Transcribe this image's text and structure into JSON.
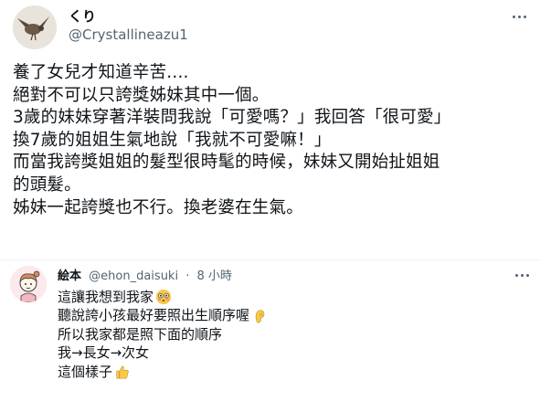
{
  "tweet": {
    "author_name": "くり",
    "author_handle": "@Crystallineazu1",
    "lines": [
      "養了女兒才知道辛苦....",
      "絕對不可以只誇獎姊妹其中一個。",
      "3歲的妹妹穿著洋裝問我說「可愛嗎？」我回答「很可愛」",
      "換7歲的姐姐生氣地說「我就不可愛嘛！」",
      "而當我誇獎姐姐的髮型很時髦的時候，妹妹又開始扯姐姐",
      "的頭髮。",
      "姊妹一起誇獎也不行。換老婆在生氣。"
    ]
  },
  "reply": {
    "author_name": "絵本",
    "author_handle": "@ehon_daisuki",
    "separator": "·",
    "timestamp": "8 小時",
    "lines": [
      {
        "text": "這讓我想到我家",
        "emoji": "flushed-face-emoji"
      },
      {
        "text": "聽說誇小孩最好要照出生順序喔",
        "emoji": "ear-emoji"
      },
      {
        "text": "所以我家都是照下面的順序",
        "emoji": ""
      },
      {
        "text": "我→長女→次女",
        "emoji": ""
      },
      {
        "text": "這個樣子",
        "emoji": "thumbs-up-emoji"
      }
    ]
  },
  "colors": {
    "text_primary": "#0f1419",
    "text_secondary": "#536471",
    "divider": "#eff3f4",
    "emoji_yellow": "#f7c948"
  }
}
